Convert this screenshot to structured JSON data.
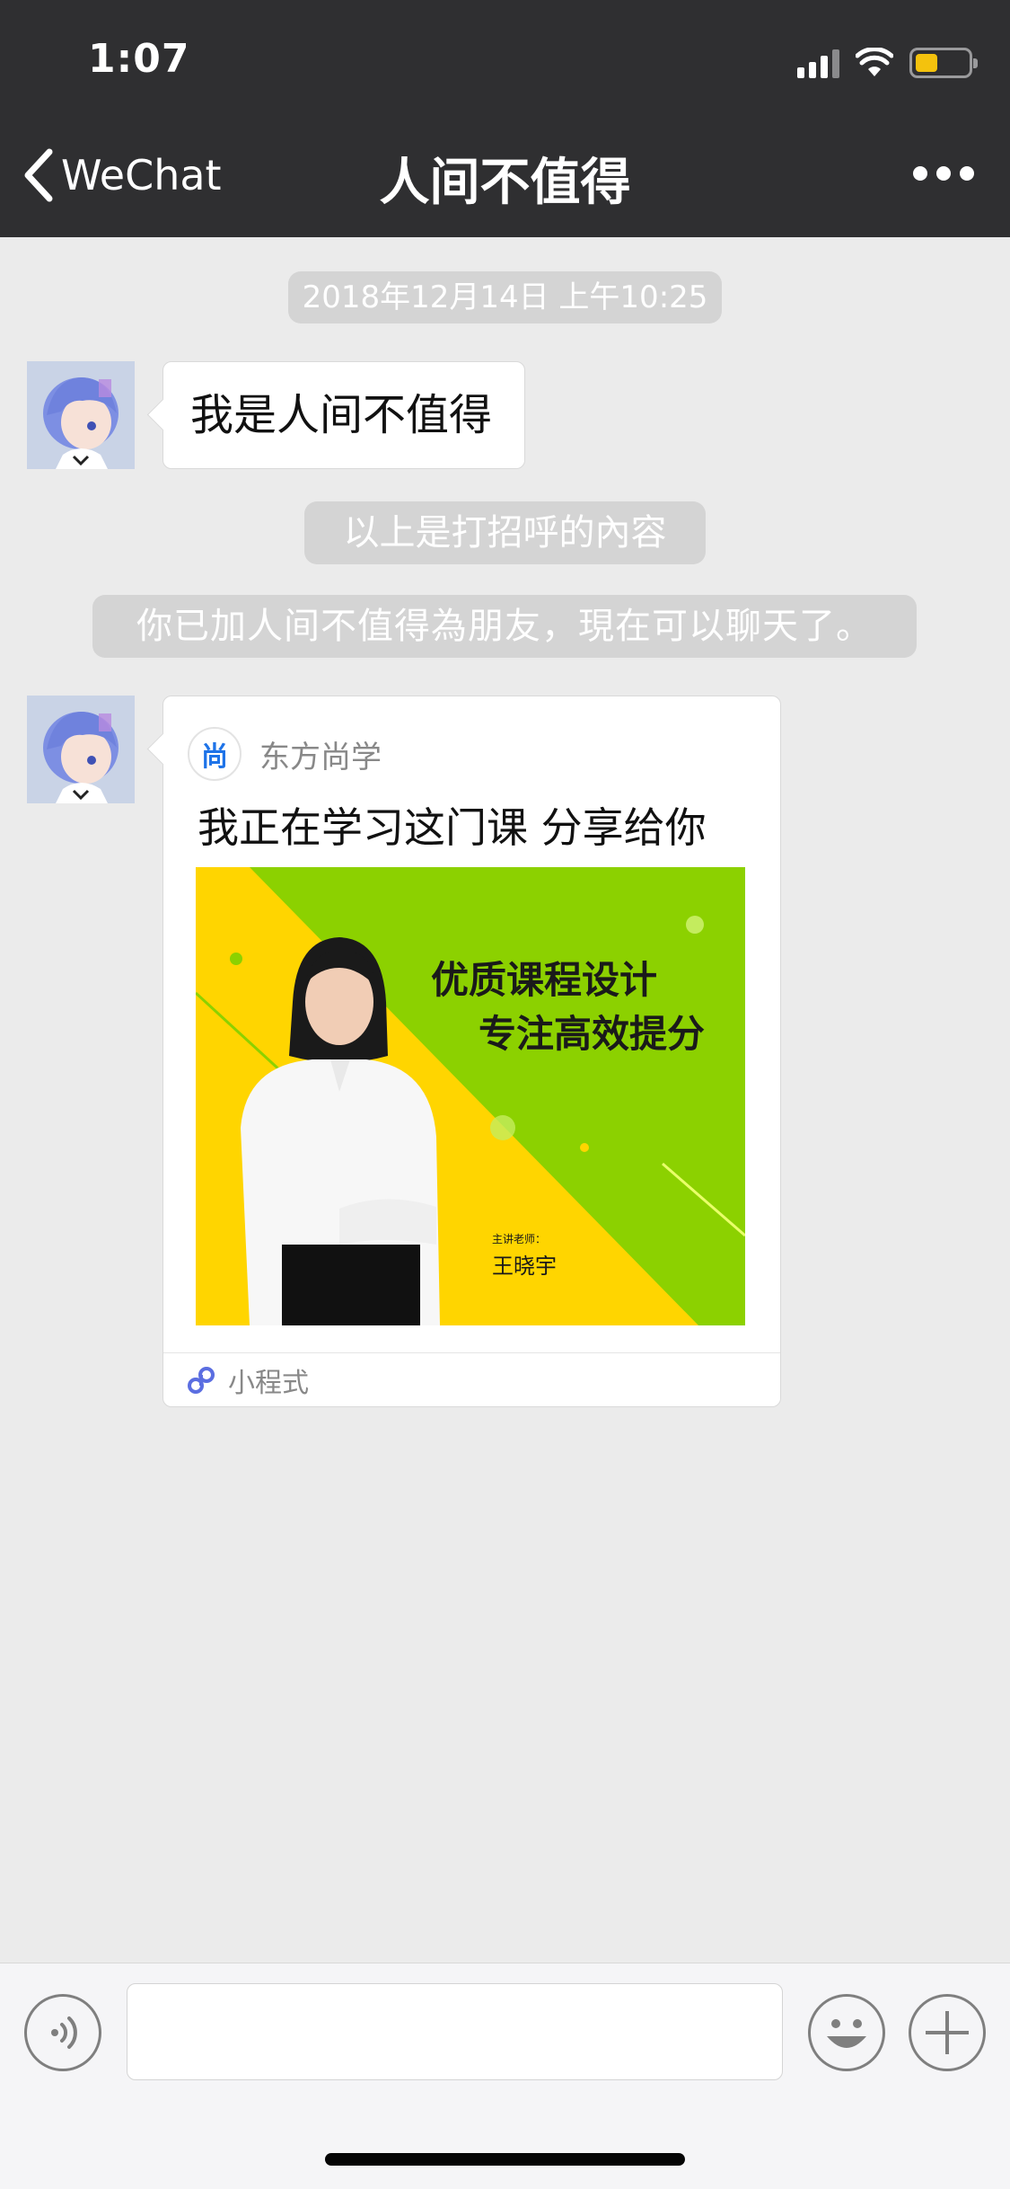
{
  "status_bar": {
    "time": "1:07"
  },
  "nav": {
    "back_label": "WeChat",
    "title": "人间不值得"
  },
  "chat": {
    "timestamp": "2018年12月14日 上午10:25",
    "greeting_message": "我是人间不值得",
    "system_greeting_note": "以上是打招呼的內容",
    "system_added_note": "你已加人间不值得為朋友，現在可以聊天了。",
    "share_card": {
      "brand": "东方尚学",
      "brand_logo_char": "尚",
      "title": "我正在学习这门课  分享给你",
      "image": {
        "headline_line1": "优质课程设计",
        "headline_line2": "专注高效提分",
        "teacher_caption": "主讲老师：",
        "teacher_name": "王晓宇"
      },
      "footer_label": "小程式"
    }
  },
  "input_bar": {
    "text_value": ""
  },
  "colors": {
    "nav_background": "#2f2f31",
    "chat_background": "#ebebeb",
    "pill_background": "#d4d4d4",
    "card_yellow": "#ffd500",
    "card_green": "#8cd100",
    "battery_fill": "#f4c20d"
  },
  "icons": {
    "back": "chevron-left-icon",
    "more": "ellipsis-icon",
    "voice": "voice-icon",
    "emoji": "emoji-icon",
    "plus": "plus-icon",
    "mini_program": "mini-program-icon",
    "signal": "signal-icon",
    "wifi": "wifi-icon",
    "battery": "battery-icon"
  }
}
